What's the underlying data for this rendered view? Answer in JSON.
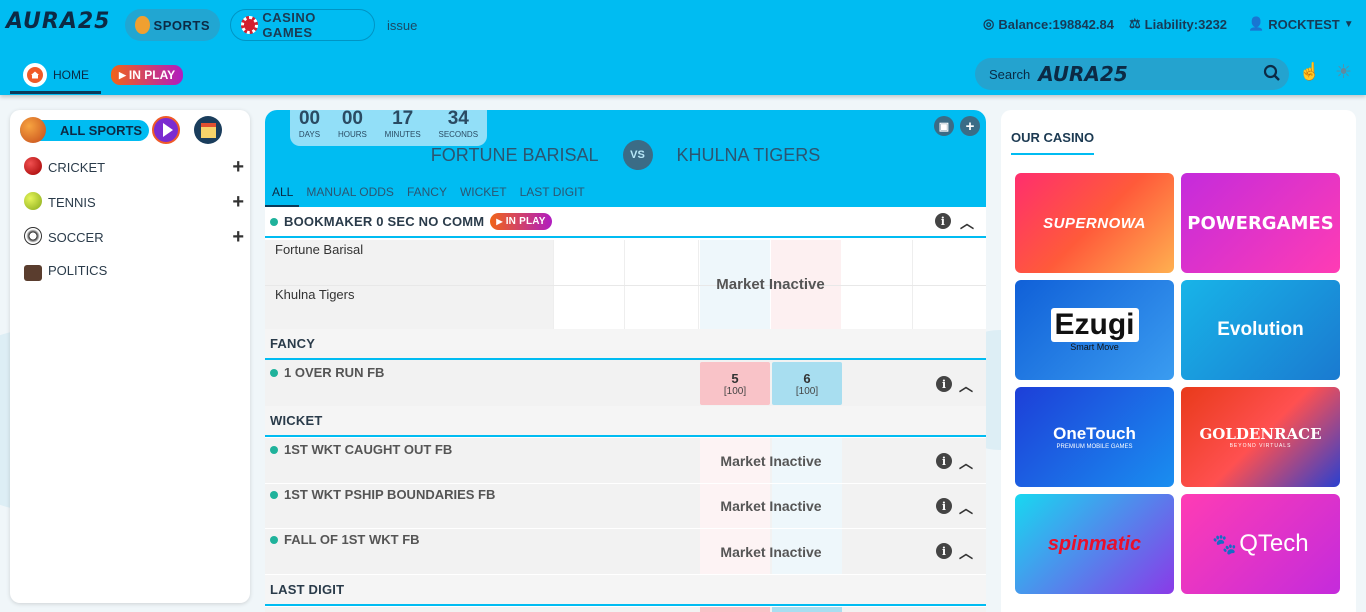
{
  "header": {
    "logo": "AURA25",
    "nav": [
      {
        "label": "SPORTS"
      },
      {
        "label": "CASINO GAMES"
      },
      {
        "label": "issue"
      }
    ],
    "balance": "Balance:198842.84",
    "liability": "Liability:3232",
    "user": "ROCKTEST",
    "home_label": "HOME",
    "inplay_label": "IN PLAY",
    "search_label": "Search",
    "search_logo": "AURA25"
  },
  "left": {
    "all_sports": "ALL SPORTS",
    "sports": [
      {
        "label": "CRICKET"
      },
      {
        "label": "TENNIS"
      },
      {
        "label": "SOCCER"
      },
      {
        "label": "POLITICS"
      }
    ]
  },
  "match": {
    "countdown": [
      {
        "value": "00",
        "unit": "DAYS"
      },
      {
        "value": "00",
        "unit": "HOURS"
      },
      {
        "value": "17",
        "unit": "MINUTES"
      },
      {
        "value": "34",
        "unit": "SECONDS"
      }
    ],
    "team_a": "FORTUNE BARISAL",
    "vs": "VS",
    "team_b": "KHULNA TIGERS",
    "tabs": [
      "ALL",
      "MANUAL ODDS",
      "FANCY",
      "WICKET",
      "LAST DIGIT"
    ],
    "bookmaker": {
      "title": "BOOKMAKER 0 SEC NO COMM",
      "badge": "IN PLAY",
      "runners": [
        "Fortune Barisal",
        "Khulna Tigers"
      ],
      "status": "Market Inactive"
    },
    "fancy": {
      "title": "FANCY",
      "market": "1 OVER RUN FB",
      "lay_value": "5",
      "lay_size": "[100]",
      "back_value": "6",
      "back_size": "[100]"
    },
    "wicket": {
      "title": "WICKET",
      "markets": [
        {
          "name": "1ST WKT CAUGHT OUT FB",
          "status": "Market Inactive"
        },
        {
          "name": "1ST WKT PSHIP BOUNDARIES FB",
          "status": "Market Inactive"
        },
        {
          "name": "FALL OF 1ST WKT FB",
          "status": "Market Inactive"
        }
      ]
    },
    "last_digit": {
      "title": "LAST DIGIT"
    }
  },
  "casino": {
    "title": "OUR CASINO",
    "tiles": [
      {
        "label": "SUPERNOWA"
      },
      {
        "label": "POWERGAMES"
      },
      {
        "label": "Ezugi",
        "sub": "Smart Move"
      },
      {
        "label": "Evolution"
      },
      {
        "label": "OneTouch",
        "sub": "PREMIUM MOBILE GAMES"
      },
      {
        "label": "GOLDENRACE",
        "sub": "BEYOND VIRTUALS"
      },
      {
        "label": "spinmatic"
      },
      {
        "label": "QTech"
      }
    ]
  }
}
